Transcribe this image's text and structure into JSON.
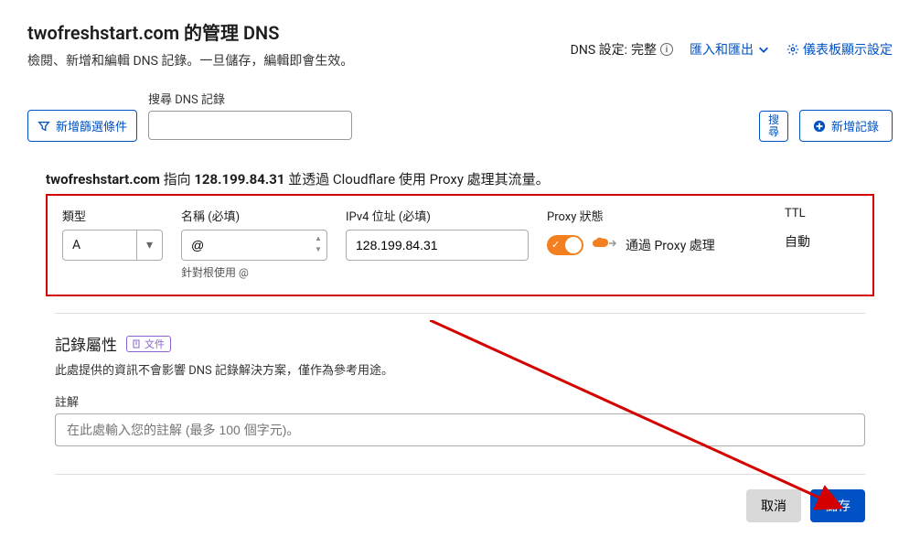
{
  "header": {
    "title": "twofreshstart.com 的管理 DNS",
    "subtitle": "檢閱、新增和編輯 DNS 記錄。一旦儲存，編輯即會生效。",
    "dns_status_label": "DNS 設定:",
    "dns_status_value": "完整",
    "import_export": "匯入和匯出",
    "dashboard_settings": "儀表板顯示設定"
  },
  "search": {
    "filter_label": "新增篩選條件",
    "label": "搜尋 DNS 記錄",
    "search_btn": "搜尋",
    "add_record": "新增記錄"
  },
  "info_line": {
    "prefix": "twofreshstart.com",
    "mid1": " 指向 ",
    "ip": "128.199.84.31",
    "mid2": " 並透過 Cloudflare 使用 Proxy 處理其流量。"
  },
  "record": {
    "type_label": "類型",
    "type_value": "A",
    "name_label": "名稱 (必填)",
    "name_value": "@",
    "name_hint": "針對根使用 @",
    "ip_label": "IPv4 位址 (必填)",
    "ip_value": "128.199.84.31",
    "proxy_label": "Proxy 狀態",
    "proxy_text": "通過 Proxy 處理",
    "ttl_label": "TTL",
    "ttl_value": "自動"
  },
  "attrs": {
    "title": "記錄屬性",
    "doc_tag": "文件",
    "desc": "此處提供的資訊不會影響 DNS 記錄解決方案，僅作為參考用途。",
    "comment_label": "註解",
    "comment_placeholder": "在此處輸入您的註解 (最多 100 個字元)。"
  },
  "footer": {
    "cancel": "取消",
    "save": "儲存"
  }
}
